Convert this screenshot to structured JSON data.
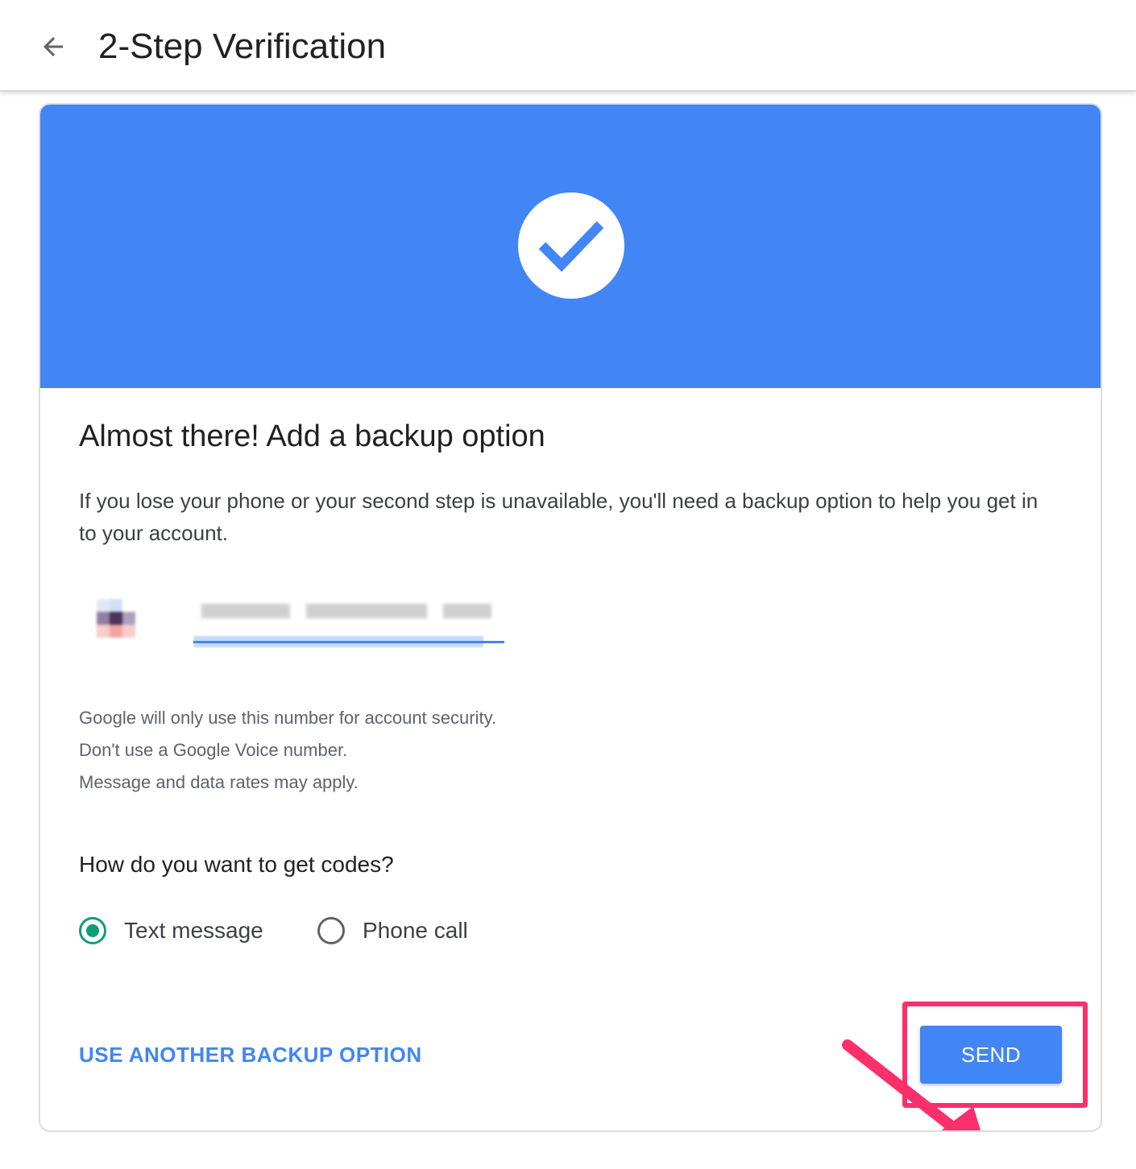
{
  "header": {
    "back_icon": "arrow-left-icon",
    "title": "2-Step Verification"
  },
  "banner": {
    "color": "#4285f4",
    "icon": "checkmark-circle-icon"
  },
  "card": {
    "title": "Almost there! Add a backup option",
    "description": "If you lose your phone or your second step is unavailable, you'll need a backup option to help you get in to your account."
  },
  "phone": {
    "country_flag_icon": "country-flag-icon"
  },
  "notes": [
    "Google will only use this number for account security.",
    "Don't use a Google Voice number.",
    "Message and data rates may apply."
  ],
  "codes": {
    "question": "How do you want to get codes?",
    "options": [
      {
        "label": "Text message",
        "selected": true
      },
      {
        "label": "Phone call",
        "selected": false
      }
    ],
    "selected_color": "#0f9d78"
  },
  "actions": {
    "alt_link": "USE ANOTHER BACKUP OPTION",
    "send_label": "SEND",
    "accent_color": "#4285f4",
    "highlight_color": "#fa2f6c"
  }
}
